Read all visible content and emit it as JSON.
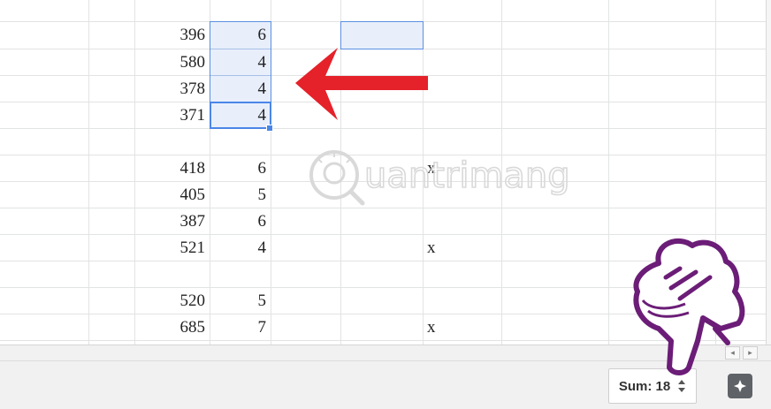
{
  "sheet": {
    "rows": [
      {
        "a": "396",
        "b": "6",
        "mark": ""
      },
      {
        "a": "580",
        "b": "4",
        "mark": ""
      },
      {
        "a": "378",
        "b": "4",
        "mark": ""
      },
      {
        "a": "371",
        "b": "4",
        "mark": ""
      },
      {
        "a": "",
        "b": "",
        "mark": ""
      },
      {
        "a": "418",
        "b": "6",
        "mark": "x"
      },
      {
        "a": "405",
        "b": "5",
        "mark": ""
      },
      {
        "a": "387",
        "b": "6",
        "mark": ""
      },
      {
        "a": "521",
        "b": "4",
        "mark": "x"
      },
      {
        "a": "",
        "b": "",
        "mark": ""
      },
      {
        "a": "520",
        "b": "5",
        "mark": ""
      },
      {
        "a": "685",
        "b": "7",
        "mark": "x"
      }
    ]
  },
  "status_bar": {
    "sum_label": "Sum: 18",
    "sum_toggle_icon": "up-down-caret-icon",
    "explore_icon": "explore-sparkle-icon"
  },
  "scroll": {
    "left_arrow": "◂",
    "right_arrow": "▸"
  },
  "watermark": {
    "text": "uantrimang"
  },
  "colors": {
    "selection_fill": "#e8effb",
    "selection_border": "#4a86e8",
    "arrow_red": "#e5212a",
    "hand_purple": "#6b1d77"
  }
}
